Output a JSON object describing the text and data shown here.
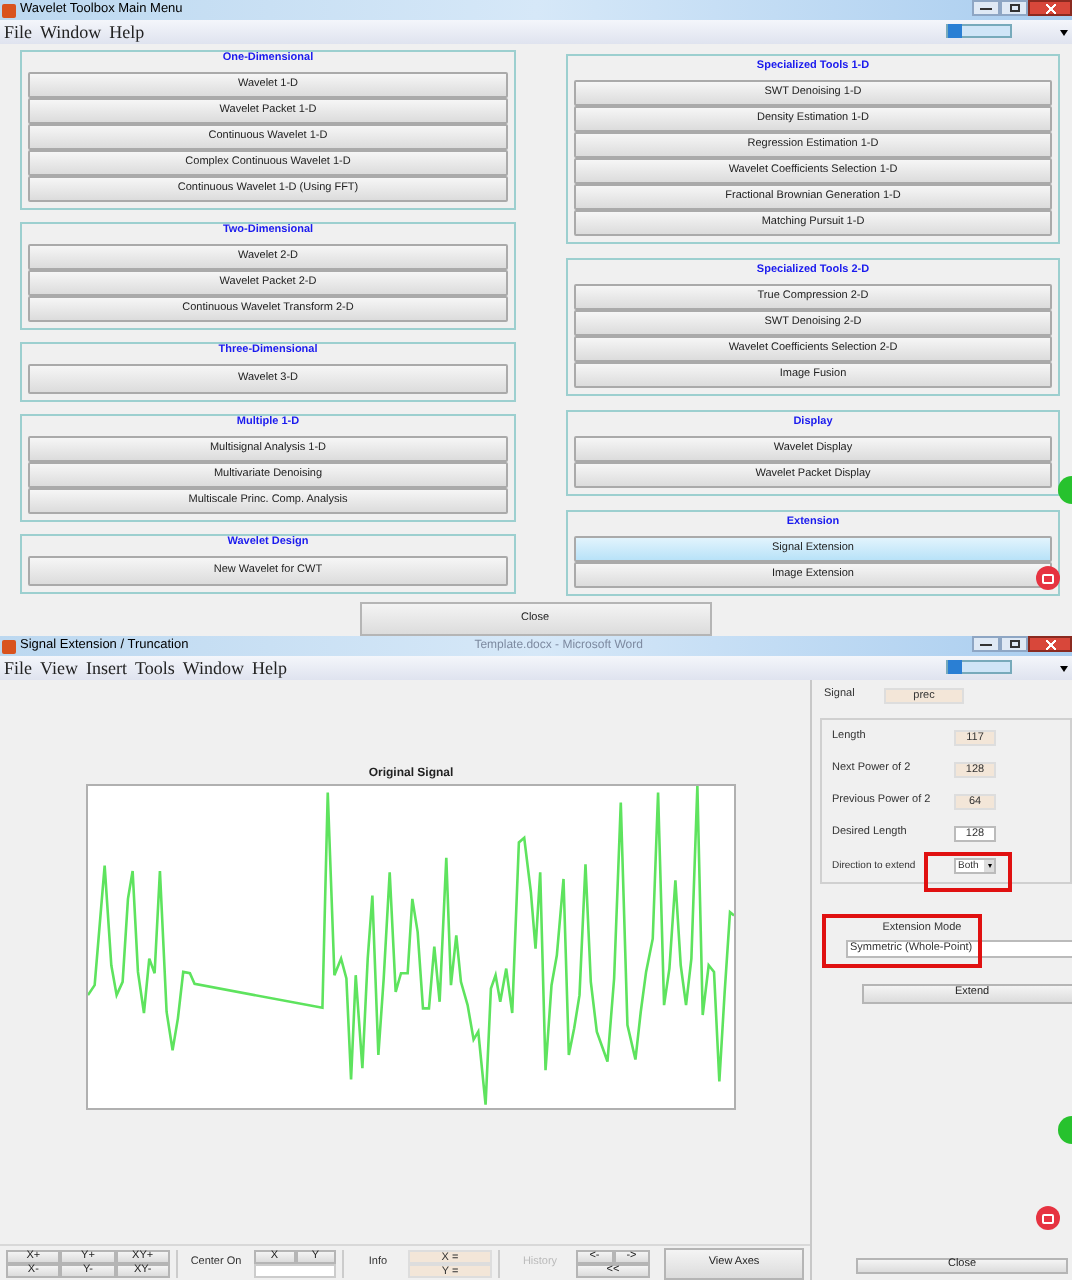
{
  "main_window": {
    "title": "Wavelet Toolbox Main Menu",
    "menu": [
      "File",
      "Window",
      "Help"
    ],
    "left_groups": [
      {
        "title": "One-Dimensional",
        "buttons": [
          {
            "label": "Wavelet 1-D",
            "selected": false
          },
          {
            "label": "Wavelet Packet 1-D",
            "selected": false
          },
          {
            "label": "Continuous Wavelet 1-D",
            "selected": false
          },
          {
            "label": "Complex Continuous Wavelet 1-D",
            "selected": false
          },
          {
            "label": "Continuous Wavelet 1-D (Using FFT)",
            "selected": false
          }
        ]
      },
      {
        "title": "Two-Dimensional",
        "buttons": [
          {
            "label": "Wavelet 2-D",
            "selected": false
          },
          {
            "label": "Wavelet Packet 2-D",
            "selected": false
          },
          {
            "label": "Continuous Wavelet Transform 2-D",
            "selected": false
          }
        ]
      },
      {
        "title": "Three-Dimensional",
        "buttons": [
          {
            "label": "Wavelet 3-D",
            "selected": false
          }
        ]
      },
      {
        "title": "Multiple 1-D",
        "buttons": [
          {
            "label": "Multisignal Analysis 1-D",
            "selected": false
          },
          {
            "label": "Multivariate Denoising",
            "selected": false
          },
          {
            "label": "Multiscale Princ. Comp. Analysis",
            "selected": false
          }
        ]
      },
      {
        "title": "Wavelet Design",
        "buttons": [
          {
            "label": "New Wavelet for CWT",
            "selected": false
          }
        ]
      }
    ],
    "right_groups": [
      {
        "title": "Specialized Tools 1-D",
        "buttons": [
          {
            "label": "SWT Denoising 1-D",
            "selected": false
          },
          {
            "label": "Density Estimation 1-D",
            "selected": false
          },
          {
            "label": "Regression Estimation 1-D",
            "selected": false
          },
          {
            "label": "Wavelet Coefficients Selection 1-D",
            "selected": false
          },
          {
            "label": "Fractional Brownian Generation 1-D",
            "selected": false
          },
          {
            "label": "Matching Pursuit 1-D",
            "selected": false
          }
        ]
      },
      {
        "title": "Specialized Tools 2-D",
        "buttons": [
          {
            "label": "True Compression 2-D",
            "selected": false
          },
          {
            "label": "SWT Denoising 2-D",
            "selected": false
          },
          {
            "label": "Wavelet Coefficients Selection 2-D",
            "selected": false
          },
          {
            "label": "Image Fusion",
            "selected": false
          }
        ]
      },
      {
        "title": "Display",
        "buttons": [
          {
            "label": "Wavelet Display",
            "selected": false
          },
          {
            "label": "Wavelet Packet Display",
            "selected": false
          }
        ]
      },
      {
        "title": "Extension",
        "buttons": [
          {
            "label": "Signal Extension",
            "selected": true
          },
          {
            "label": "Image Extension",
            "selected": false
          }
        ]
      }
    ],
    "close": "Close"
  },
  "extension_window": {
    "title": "Signal Extension / Truncation",
    "background_title": "Template.docx - Microsoft Word",
    "menu": [
      "File",
      "View",
      "Insert",
      "Tools",
      "Window",
      "Help"
    ],
    "plot_title": "Original Signal",
    "signal": {
      "label": "Signal",
      "value": "prec"
    },
    "fields": [
      {
        "label": "Length",
        "value": "117",
        "editable": false
      },
      {
        "label": "Next Power of 2",
        "value": "128",
        "editable": false
      },
      {
        "label": "Previous Power of 2",
        "value": "64",
        "editable": false
      },
      {
        "label": "Desired Length",
        "value": "128",
        "editable": true
      }
    ],
    "direction": {
      "label": "Direction to extend",
      "value": "Both"
    },
    "mode": {
      "label": "Extension Mode",
      "value": "Symmetric (Whole-Point)"
    },
    "extend": "Extend",
    "close": "Close",
    "toolbar": {
      "zoom_buttons": [
        "X+",
        "Y+",
        "XY+",
        "X-",
        "Y-",
        "XY-"
      ],
      "center_label": "Center On",
      "center_buttons": [
        "X",
        "Y"
      ],
      "info_label": "Info",
      "info_fields": [
        "X =",
        "Y ="
      ],
      "history": {
        "label": "History",
        "disabled": true
      },
      "history_buttons": [
        "<-",
        "->",
        "<<"
      ],
      "view_axes": "View Axes"
    }
  }
}
